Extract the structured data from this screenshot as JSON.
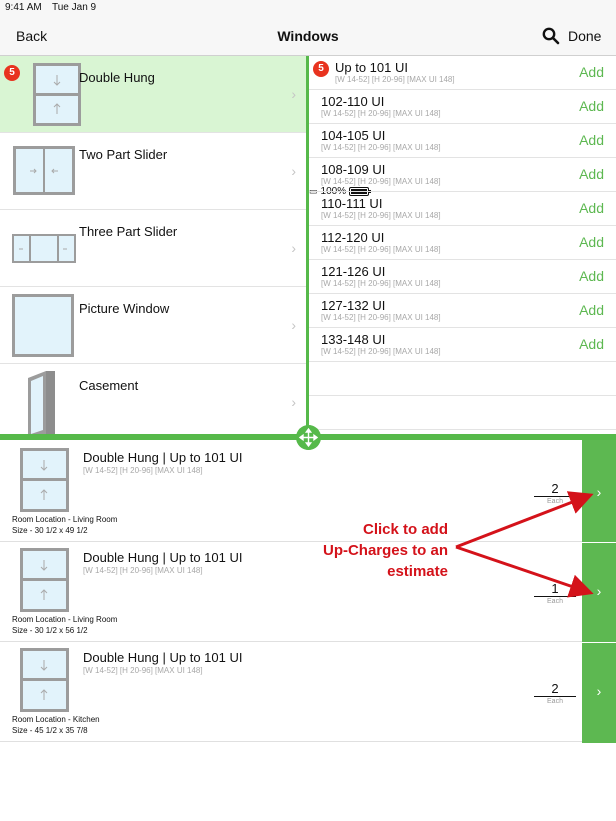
{
  "status_bar": {
    "time": "9:41 AM",
    "date": "Tue Jan 9",
    "battery": "100%"
  },
  "nav": {
    "back": "Back",
    "title": "Windows",
    "done": "Done"
  },
  "window_types": [
    {
      "name": "Double Hung",
      "badge": "5",
      "selected": true
    },
    {
      "name": "Two Part Slider"
    },
    {
      "name": "Three Part Slider"
    },
    {
      "name": "Picture Window"
    },
    {
      "name": "Casement"
    }
  ],
  "size_options": [
    {
      "label": "Up to 101 UI",
      "sub": "[W 14-52] [H 20-96] [MAX UI 148]",
      "add": "Add",
      "badge": "5"
    },
    {
      "label": "102-110 UI",
      "sub": "[W 14-52] [H 20-96] [MAX UI 148]",
      "add": "Add"
    },
    {
      "label": "104-105 UI",
      "sub": "[W 14-52] [H 20-96] [MAX UI 148]",
      "add": "Add"
    },
    {
      "label": "108-109 UI",
      "sub": "[W 14-52] [H 20-96] [MAX UI 148]",
      "add": "Add"
    },
    {
      "label": "110-111 UI",
      "sub": "[W 14-52] [H 20-96] [MAX UI 148]",
      "add": "Add"
    },
    {
      "label": "112-120 UI",
      "sub": "[W 14-52] [H 20-96] [MAX UI 148]",
      "add": "Add"
    },
    {
      "label": "121-126 UI",
      "sub": "[W 14-52] [H 20-96] [MAX UI 148]",
      "add": "Add"
    },
    {
      "label": "127-132 UI",
      "sub": "[W 14-52] [H 20-96] [MAX UI 148]",
      "add": "Add"
    },
    {
      "label": "133-148 UI",
      "sub": "[W 14-52] [H 20-96] [MAX UI 148]",
      "add": "Add"
    }
  ],
  "estimate_items": [
    {
      "title": "Double Hung | Up to 101 UI",
      "sub": "[W 14-52] [H 20-96] [MAX UI 148]",
      "location": "Room Location - Living Room",
      "size": "Size - 30 1/2 x 49 1/2",
      "qty": "2",
      "each": "Each"
    },
    {
      "title": "Double Hung | Up to 101 UI",
      "sub": "[W 14-52] [H 20-96] [MAX UI 148]",
      "location": "Room Location - Living Room",
      "size": "Size - 30 1/2 x 56 1/2",
      "qty": "1",
      "each": "Each"
    },
    {
      "title": "Double Hung | Up to 101 UI",
      "sub": "[W 14-52] [H 20-96] [MAX UI 148]",
      "location": "Room Location - Kitchen",
      "size": "Size - 45 1/2 x 35 7/8",
      "qty": "2",
      "each": "Each"
    }
  ],
  "annotation": {
    "line1": "Click to add",
    "line2": "Up-Charges to an",
    "line3": "estimate"
  },
  "colors": {
    "accent_green": "#56b94a",
    "badge_red": "#e8331f",
    "annotation_red": "#d4121a",
    "selected_bg": "#d9f5d3"
  },
  "icons": [
    "search-icon",
    "battery-icon",
    "chevron-right-icon",
    "move-handle-icon",
    "double-hung-window-icon",
    "two-part-slider-icon",
    "three-part-slider-icon",
    "picture-window-icon",
    "casement-window-icon"
  ]
}
